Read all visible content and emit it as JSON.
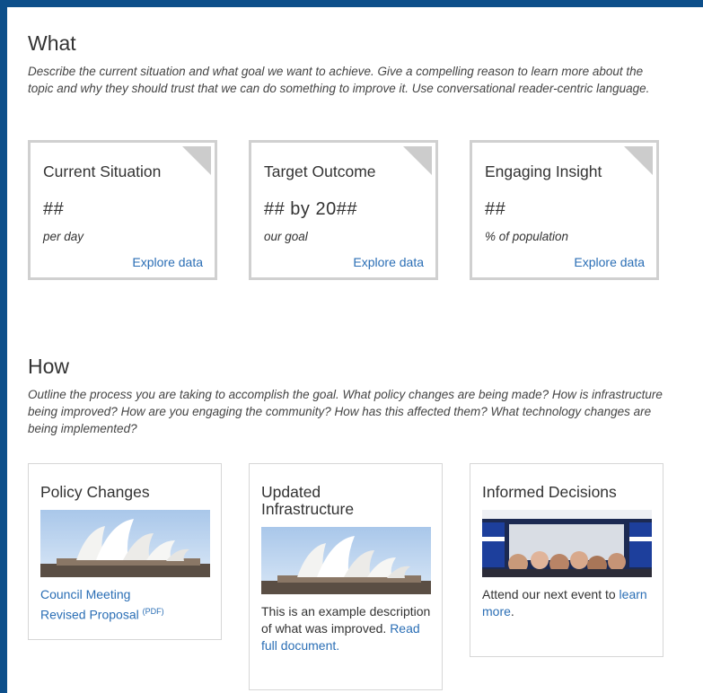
{
  "what": {
    "title": "What",
    "description": "Describe the current situation and what goal we want to achieve. Give a compelling reason to learn more about the topic and why they should trust that we can do something to improve it. Use conversational reader-centric language.",
    "cards": [
      {
        "title": "Current Situation",
        "value": "##",
        "subtitle": "per day",
        "link": "Explore data"
      },
      {
        "title": "Target Outcome",
        "value": "## by 20##",
        "subtitle": "our goal",
        "link": "Explore data"
      },
      {
        "title": "Engaging Insight",
        "value": "##",
        "subtitle": "% of population",
        "link": "Explore data"
      }
    ]
  },
  "how": {
    "title": "How",
    "description": "Outline the process you are taking to accomplish the goal. What policy changes are being made? How is infrastructure being improved? How are you engaging the community? How has this affected them? What technology changes are being implemented?",
    "cards": [
      {
        "title": "Policy Changes",
        "link1": "Council Meeting",
        "link2": "Revised Proposal",
        "link2_suffix": "(PDF)"
      },
      {
        "title": "Updated Infrastructure",
        "text": "This is an example description of what was improved.",
        "link": "Read full document",
        "link_suffix": "."
      },
      {
        "title": "Informed Decisions",
        "text": "Attend our next event to",
        "link": "learn more",
        "link_suffix": "."
      }
    ]
  },
  "colors": {
    "link": "#2a6eb5",
    "background": "#0d4f8a",
    "border": "#d0d0d0"
  }
}
